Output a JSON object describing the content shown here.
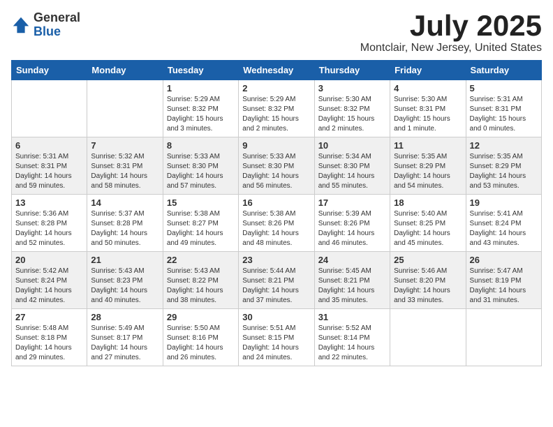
{
  "header": {
    "logo_general": "General",
    "logo_blue": "Blue",
    "month_title": "July 2025",
    "location": "Montclair, New Jersey, United States"
  },
  "weekdays": [
    "Sunday",
    "Monday",
    "Tuesday",
    "Wednesday",
    "Thursday",
    "Friday",
    "Saturday"
  ],
  "weeks": [
    [
      {
        "day": "",
        "sunrise": "",
        "sunset": "",
        "daylight": ""
      },
      {
        "day": "",
        "sunrise": "",
        "sunset": "",
        "daylight": ""
      },
      {
        "day": "1",
        "sunrise": "Sunrise: 5:29 AM",
        "sunset": "Sunset: 8:32 PM",
        "daylight": "Daylight: 15 hours and 3 minutes."
      },
      {
        "day": "2",
        "sunrise": "Sunrise: 5:29 AM",
        "sunset": "Sunset: 8:32 PM",
        "daylight": "Daylight: 15 hours and 2 minutes."
      },
      {
        "day": "3",
        "sunrise": "Sunrise: 5:30 AM",
        "sunset": "Sunset: 8:32 PM",
        "daylight": "Daylight: 15 hours and 2 minutes."
      },
      {
        "day": "4",
        "sunrise": "Sunrise: 5:30 AM",
        "sunset": "Sunset: 8:31 PM",
        "daylight": "Daylight: 15 hours and 1 minute."
      },
      {
        "day": "5",
        "sunrise": "Sunrise: 5:31 AM",
        "sunset": "Sunset: 8:31 PM",
        "daylight": "Daylight: 15 hours and 0 minutes."
      }
    ],
    [
      {
        "day": "6",
        "sunrise": "Sunrise: 5:31 AM",
        "sunset": "Sunset: 8:31 PM",
        "daylight": "Daylight: 14 hours and 59 minutes."
      },
      {
        "day": "7",
        "sunrise": "Sunrise: 5:32 AM",
        "sunset": "Sunset: 8:31 PM",
        "daylight": "Daylight: 14 hours and 58 minutes."
      },
      {
        "day": "8",
        "sunrise": "Sunrise: 5:33 AM",
        "sunset": "Sunset: 8:30 PM",
        "daylight": "Daylight: 14 hours and 57 minutes."
      },
      {
        "day": "9",
        "sunrise": "Sunrise: 5:33 AM",
        "sunset": "Sunset: 8:30 PM",
        "daylight": "Daylight: 14 hours and 56 minutes."
      },
      {
        "day": "10",
        "sunrise": "Sunrise: 5:34 AM",
        "sunset": "Sunset: 8:30 PM",
        "daylight": "Daylight: 14 hours and 55 minutes."
      },
      {
        "day": "11",
        "sunrise": "Sunrise: 5:35 AM",
        "sunset": "Sunset: 8:29 PM",
        "daylight": "Daylight: 14 hours and 54 minutes."
      },
      {
        "day": "12",
        "sunrise": "Sunrise: 5:35 AM",
        "sunset": "Sunset: 8:29 PM",
        "daylight": "Daylight: 14 hours and 53 minutes."
      }
    ],
    [
      {
        "day": "13",
        "sunrise": "Sunrise: 5:36 AM",
        "sunset": "Sunset: 8:28 PM",
        "daylight": "Daylight: 14 hours and 52 minutes."
      },
      {
        "day": "14",
        "sunrise": "Sunrise: 5:37 AM",
        "sunset": "Sunset: 8:28 PM",
        "daylight": "Daylight: 14 hours and 50 minutes."
      },
      {
        "day": "15",
        "sunrise": "Sunrise: 5:38 AM",
        "sunset": "Sunset: 8:27 PM",
        "daylight": "Daylight: 14 hours and 49 minutes."
      },
      {
        "day": "16",
        "sunrise": "Sunrise: 5:38 AM",
        "sunset": "Sunset: 8:26 PM",
        "daylight": "Daylight: 14 hours and 48 minutes."
      },
      {
        "day": "17",
        "sunrise": "Sunrise: 5:39 AM",
        "sunset": "Sunset: 8:26 PM",
        "daylight": "Daylight: 14 hours and 46 minutes."
      },
      {
        "day": "18",
        "sunrise": "Sunrise: 5:40 AM",
        "sunset": "Sunset: 8:25 PM",
        "daylight": "Daylight: 14 hours and 45 minutes."
      },
      {
        "day": "19",
        "sunrise": "Sunrise: 5:41 AM",
        "sunset": "Sunset: 8:24 PM",
        "daylight": "Daylight: 14 hours and 43 minutes."
      }
    ],
    [
      {
        "day": "20",
        "sunrise": "Sunrise: 5:42 AM",
        "sunset": "Sunset: 8:24 PM",
        "daylight": "Daylight: 14 hours and 42 minutes."
      },
      {
        "day": "21",
        "sunrise": "Sunrise: 5:43 AM",
        "sunset": "Sunset: 8:23 PM",
        "daylight": "Daylight: 14 hours and 40 minutes."
      },
      {
        "day": "22",
        "sunrise": "Sunrise: 5:43 AM",
        "sunset": "Sunset: 8:22 PM",
        "daylight": "Daylight: 14 hours and 38 minutes."
      },
      {
        "day": "23",
        "sunrise": "Sunrise: 5:44 AM",
        "sunset": "Sunset: 8:21 PM",
        "daylight": "Daylight: 14 hours and 37 minutes."
      },
      {
        "day": "24",
        "sunrise": "Sunrise: 5:45 AM",
        "sunset": "Sunset: 8:21 PM",
        "daylight": "Daylight: 14 hours and 35 minutes."
      },
      {
        "day": "25",
        "sunrise": "Sunrise: 5:46 AM",
        "sunset": "Sunset: 8:20 PM",
        "daylight": "Daylight: 14 hours and 33 minutes."
      },
      {
        "day": "26",
        "sunrise": "Sunrise: 5:47 AM",
        "sunset": "Sunset: 8:19 PM",
        "daylight": "Daylight: 14 hours and 31 minutes."
      }
    ],
    [
      {
        "day": "27",
        "sunrise": "Sunrise: 5:48 AM",
        "sunset": "Sunset: 8:18 PM",
        "daylight": "Daylight: 14 hours and 29 minutes."
      },
      {
        "day": "28",
        "sunrise": "Sunrise: 5:49 AM",
        "sunset": "Sunset: 8:17 PM",
        "daylight": "Daylight: 14 hours and 27 minutes."
      },
      {
        "day": "29",
        "sunrise": "Sunrise: 5:50 AM",
        "sunset": "Sunset: 8:16 PM",
        "daylight": "Daylight: 14 hours and 26 minutes."
      },
      {
        "day": "30",
        "sunrise": "Sunrise: 5:51 AM",
        "sunset": "Sunset: 8:15 PM",
        "daylight": "Daylight: 14 hours and 24 minutes."
      },
      {
        "day": "31",
        "sunrise": "Sunrise: 5:52 AM",
        "sunset": "Sunset: 8:14 PM",
        "daylight": "Daylight: 14 hours and 22 minutes."
      },
      {
        "day": "",
        "sunrise": "",
        "sunset": "",
        "daylight": ""
      },
      {
        "day": "",
        "sunrise": "",
        "sunset": "",
        "daylight": ""
      }
    ]
  ]
}
